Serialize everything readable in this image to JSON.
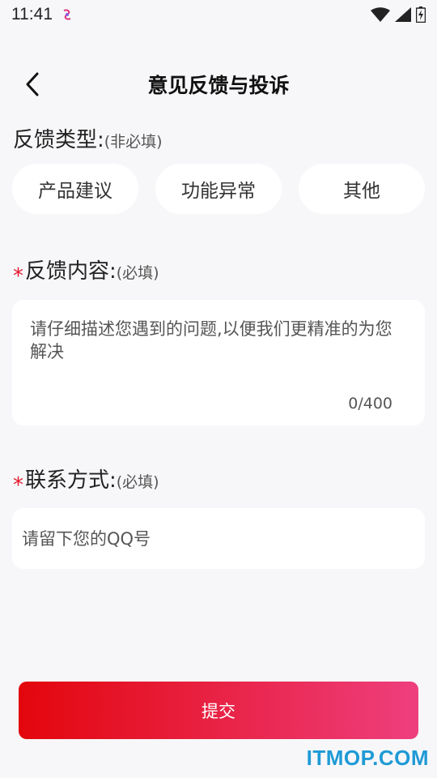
{
  "status_bar": {
    "time": "11:41",
    "icons": [
      "app-notification-icon",
      "wifi-icon",
      "cellular-signal-icon",
      "battery-icon"
    ]
  },
  "header": {
    "title": "意见反馈与投诉",
    "back_icon": "chevron-left-icon"
  },
  "feedback_type": {
    "label": "反馈类型:",
    "hint": "(非必填)",
    "options": [
      "产品建议",
      "功能异常",
      "其他"
    ]
  },
  "feedback_content": {
    "required_mark": "*",
    "label": "反馈内容:",
    "hint": "(必填)",
    "placeholder": "请仔细描述您遇到的问题,以便我们更精准的为您解决",
    "counter": "0/400"
  },
  "contact": {
    "required_mark": "*",
    "label": "联系方式:",
    "hint": "(必填)",
    "placeholder": "请留下您的QQ号"
  },
  "submit": {
    "label": "提交"
  },
  "watermark": "ITMOP.COM",
  "colors": {
    "accent_start": "#e3060c",
    "accent_end": "#ee3f7e",
    "required": "#e5162a",
    "background": "#f7f7f9",
    "watermark": "#1f9ad6"
  }
}
